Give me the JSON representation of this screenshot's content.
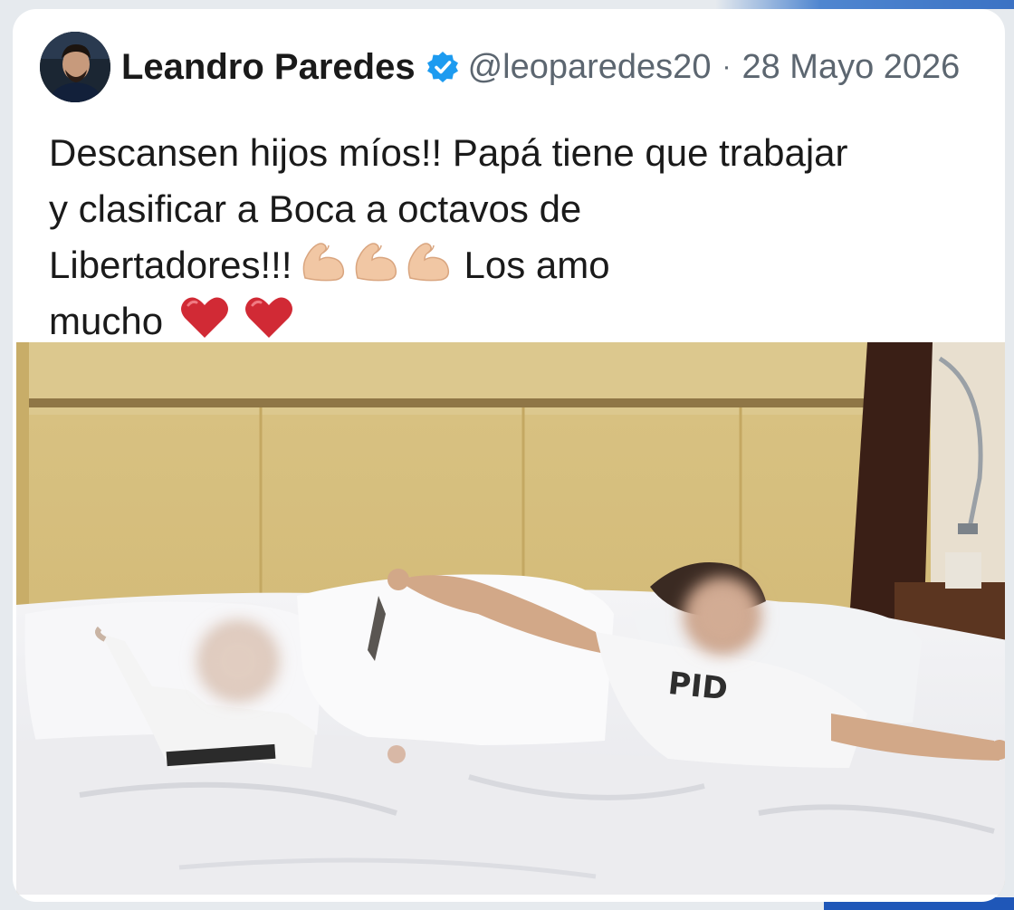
{
  "tweet": {
    "author_name": "Leandro Paredes",
    "handle": "@leoparedes20",
    "separator": "·",
    "date": "28 Mayo 2026",
    "text_line1": "Descansen hijos míos!! Papá tiene que trabajar",
    "text_line2": "y clasificar a Boca a octavos de",
    "text_line3_start": "Libertadores!!!",
    "text_line3_end": "Los amo",
    "text_line4": "mucho",
    "emojis": [
      "flexed-biceps-icon",
      "flexed-biceps-icon",
      "flexed-biceps-icon",
      "red-heart-icon",
      "red-heart-icon"
    ]
  },
  "colors": {
    "verified": "#1d9bf0",
    "text": "#1a1a1a",
    "secondary_text": "#5c6670",
    "heart": "#d12a35",
    "accent": "#1f57b8"
  }
}
